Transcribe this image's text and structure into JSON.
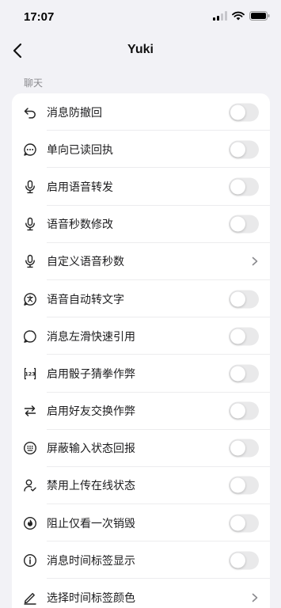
{
  "status_bar": {
    "time": "17:07"
  },
  "nav": {
    "title": "Yuki"
  },
  "section": {
    "title": "聊天"
  },
  "colors": {
    "background": "#f2f2f6",
    "card": "#ffffff",
    "toggle_off": "#e9e9ea",
    "text": "#1c1c1e",
    "section_header": "#8a8a8e"
  },
  "settings": [
    {
      "label": "消息防撤回",
      "icon": "undo-arrow-icon",
      "control": "toggle",
      "on": false
    },
    {
      "label": "单向已读回执",
      "icon": "chat-dots-icon",
      "control": "toggle",
      "on": false
    },
    {
      "label": "启用语音转发",
      "icon": "microphone-icon",
      "control": "toggle",
      "on": false
    },
    {
      "label": "语音秒数修改",
      "icon": "microphone-icon",
      "control": "toggle",
      "on": false
    },
    {
      "label": "自定义语音秒数",
      "icon": "microphone-icon",
      "control": "chevron"
    },
    {
      "label": "语音自动转文字",
      "icon": "translate-bubble-icon",
      "control": "toggle",
      "on": false
    },
    {
      "label": "消息左滑快速引用",
      "icon": "speech-bubble-icon",
      "control": "toggle",
      "on": false
    },
    {
      "label": "启用骰子猜拳作弊",
      "icon": "number-box-icon",
      "control": "toggle",
      "on": false
    },
    {
      "label": "启用好友交换作弊",
      "icon": "swap-arrows-icon",
      "control": "toggle",
      "on": false
    },
    {
      "label": "屏蔽输入状态回报",
      "icon": "keypad-icon",
      "control": "toggle",
      "on": false
    },
    {
      "label": "禁用上传在线状态",
      "icon": "person-check-icon",
      "control": "toggle",
      "on": false
    },
    {
      "label": "阻止仅看一次销毁",
      "icon": "fire-circle-icon",
      "control": "toggle",
      "on": false
    },
    {
      "label": "消息时间标签显示",
      "icon": "info-circle-icon",
      "control": "toggle",
      "on": false
    },
    {
      "label": "选择时间标签颜色",
      "icon": "pen-icon",
      "control": "chevron"
    }
  ]
}
